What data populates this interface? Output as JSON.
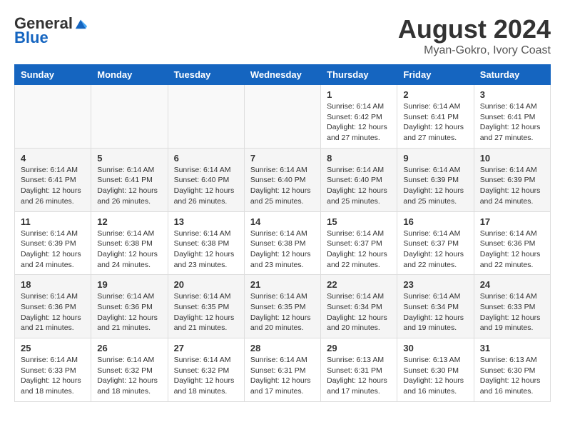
{
  "header": {
    "logo_general": "General",
    "logo_blue": "Blue",
    "month_title": "August 2024",
    "location": "Myan-Gokro, Ivory Coast"
  },
  "days_of_week": [
    "Sunday",
    "Monday",
    "Tuesday",
    "Wednesday",
    "Thursday",
    "Friday",
    "Saturday"
  ],
  "weeks": [
    [
      {
        "day": "",
        "info": ""
      },
      {
        "day": "",
        "info": ""
      },
      {
        "day": "",
        "info": ""
      },
      {
        "day": "",
        "info": ""
      },
      {
        "day": "1",
        "info": "Sunrise: 6:14 AM\nSunset: 6:42 PM\nDaylight: 12 hours\nand 27 minutes."
      },
      {
        "day": "2",
        "info": "Sunrise: 6:14 AM\nSunset: 6:41 PM\nDaylight: 12 hours\nand 27 minutes."
      },
      {
        "day": "3",
        "info": "Sunrise: 6:14 AM\nSunset: 6:41 PM\nDaylight: 12 hours\nand 27 minutes."
      }
    ],
    [
      {
        "day": "4",
        "info": "Sunrise: 6:14 AM\nSunset: 6:41 PM\nDaylight: 12 hours\nand 26 minutes."
      },
      {
        "day": "5",
        "info": "Sunrise: 6:14 AM\nSunset: 6:41 PM\nDaylight: 12 hours\nand 26 minutes."
      },
      {
        "day": "6",
        "info": "Sunrise: 6:14 AM\nSunset: 6:40 PM\nDaylight: 12 hours\nand 26 minutes."
      },
      {
        "day": "7",
        "info": "Sunrise: 6:14 AM\nSunset: 6:40 PM\nDaylight: 12 hours\nand 25 minutes."
      },
      {
        "day": "8",
        "info": "Sunrise: 6:14 AM\nSunset: 6:40 PM\nDaylight: 12 hours\nand 25 minutes."
      },
      {
        "day": "9",
        "info": "Sunrise: 6:14 AM\nSunset: 6:39 PM\nDaylight: 12 hours\nand 25 minutes."
      },
      {
        "day": "10",
        "info": "Sunrise: 6:14 AM\nSunset: 6:39 PM\nDaylight: 12 hours\nand 24 minutes."
      }
    ],
    [
      {
        "day": "11",
        "info": "Sunrise: 6:14 AM\nSunset: 6:39 PM\nDaylight: 12 hours\nand 24 minutes."
      },
      {
        "day": "12",
        "info": "Sunrise: 6:14 AM\nSunset: 6:38 PM\nDaylight: 12 hours\nand 24 minutes."
      },
      {
        "day": "13",
        "info": "Sunrise: 6:14 AM\nSunset: 6:38 PM\nDaylight: 12 hours\nand 23 minutes."
      },
      {
        "day": "14",
        "info": "Sunrise: 6:14 AM\nSunset: 6:38 PM\nDaylight: 12 hours\nand 23 minutes."
      },
      {
        "day": "15",
        "info": "Sunrise: 6:14 AM\nSunset: 6:37 PM\nDaylight: 12 hours\nand 22 minutes."
      },
      {
        "day": "16",
        "info": "Sunrise: 6:14 AM\nSunset: 6:37 PM\nDaylight: 12 hours\nand 22 minutes."
      },
      {
        "day": "17",
        "info": "Sunrise: 6:14 AM\nSunset: 6:36 PM\nDaylight: 12 hours\nand 22 minutes."
      }
    ],
    [
      {
        "day": "18",
        "info": "Sunrise: 6:14 AM\nSunset: 6:36 PM\nDaylight: 12 hours\nand 21 minutes."
      },
      {
        "day": "19",
        "info": "Sunrise: 6:14 AM\nSunset: 6:36 PM\nDaylight: 12 hours\nand 21 minutes."
      },
      {
        "day": "20",
        "info": "Sunrise: 6:14 AM\nSunset: 6:35 PM\nDaylight: 12 hours\nand 21 minutes."
      },
      {
        "day": "21",
        "info": "Sunrise: 6:14 AM\nSunset: 6:35 PM\nDaylight: 12 hours\nand 20 minutes."
      },
      {
        "day": "22",
        "info": "Sunrise: 6:14 AM\nSunset: 6:34 PM\nDaylight: 12 hours\nand 20 minutes."
      },
      {
        "day": "23",
        "info": "Sunrise: 6:14 AM\nSunset: 6:34 PM\nDaylight: 12 hours\nand 19 minutes."
      },
      {
        "day": "24",
        "info": "Sunrise: 6:14 AM\nSunset: 6:33 PM\nDaylight: 12 hours\nand 19 minutes."
      }
    ],
    [
      {
        "day": "25",
        "info": "Sunrise: 6:14 AM\nSunset: 6:33 PM\nDaylight: 12 hours\nand 18 minutes."
      },
      {
        "day": "26",
        "info": "Sunrise: 6:14 AM\nSunset: 6:32 PM\nDaylight: 12 hours\nand 18 minutes."
      },
      {
        "day": "27",
        "info": "Sunrise: 6:14 AM\nSunset: 6:32 PM\nDaylight: 12 hours\nand 18 minutes."
      },
      {
        "day": "28",
        "info": "Sunrise: 6:14 AM\nSunset: 6:31 PM\nDaylight: 12 hours\nand 17 minutes."
      },
      {
        "day": "29",
        "info": "Sunrise: 6:13 AM\nSunset: 6:31 PM\nDaylight: 12 hours\nand 17 minutes."
      },
      {
        "day": "30",
        "info": "Sunrise: 6:13 AM\nSunset: 6:30 PM\nDaylight: 12 hours\nand 16 minutes."
      },
      {
        "day": "31",
        "info": "Sunrise: 6:13 AM\nSunset: 6:30 PM\nDaylight: 12 hours\nand 16 minutes."
      }
    ]
  ]
}
